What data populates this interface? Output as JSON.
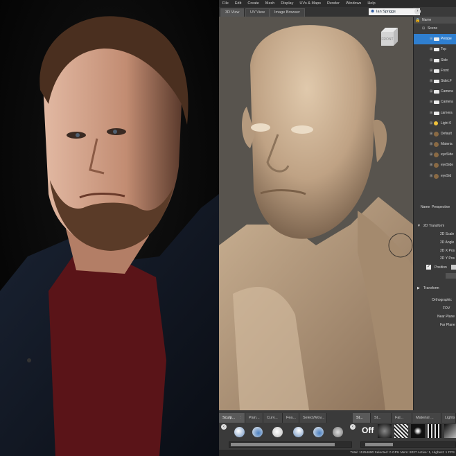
{
  "menu": [
    "File",
    "Edit",
    "Create",
    "Mesh",
    "Display",
    "UVs & Maps",
    "Render",
    "Windows",
    "Help"
  ],
  "view_tabs": [
    "3D View",
    "UV View",
    "Image Browser"
  ],
  "user": "Ian Spriggs",
  "nav_cube": "FRONT",
  "outliner": {
    "header": "Name",
    "scene": "Scene",
    "rows": [
      {
        "label": "Perspe",
        "type": "camera-icon",
        "selected": true
      },
      {
        "label": "Top",
        "type": "camera-icon"
      },
      {
        "label": "Side",
        "type": "camera-icon"
      },
      {
        "label": "Front",
        "type": "camera-icon"
      },
      {
        "label": "SideLF",
        "type": "camera-icon"
      },
      {
        "label": "Camera",
        "type": "camera-icon"
      },
      {
        "label": "Camera",
        "type": "camera-icon"
      },
      {
        "label": "camera",
        "type": "camera-icon"
      },
      {
        "label": "Light 0",
        "type": "light-icon"
      },
      {
        "label": "Default",
        "type": "material-icon"
      },
      {
        "label": "Materia",
        "type": "material-icon"
      },
      {
        "label": "eyeSide",
        "type": "material-icon"
      },
      {
        "label": "eyeSide",
        "type": "material-icon"
      },
      {
        "label": "eyeSid",
        "type": "material-icon"
      }
    ]
  },
  "properties": {
    "name_label": "Name",
    "name_value": "Perspective",
    "section_2d": "2D Transform",
    "fields_2d": [
      "2D Scale",
      "2D Angle",
      "2D X Pos",
      "2D Y Pos"
    ],
    "position_label": "Position",
    "section_transform": "Transform",
    "fields_transform": [
      "Orthographic",
      "FOV",
      "Near Plane",
      "Far Plane"
    ]
  },
  "bottom_tabs": [
    "Sculp...",
    "Pain...",
    "Curv...",
    "Fea...",
    "Select/Mov...",
    "St...",
    "St...",
    "Fal...",
    "Material ...",
    "Lights"
  ],
  "stamp_off": "Off",
  "status_bar": "Total: 11254690  Selected: 0  GPU Mem: 8027  Active: 1, Highest: 1  FPS"
}
